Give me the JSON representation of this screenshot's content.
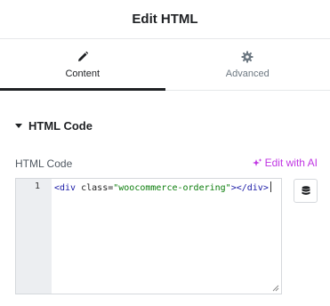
{
  "header": {
    "title": "Edit HTML"
  },
  "tabs": [
    {
      "label": "Content",
      "icon": "pencil-icon",
      "active": true
    },
    {
      "label": "Advanced",
      "icon": "gear-icon",
      "active": false
    }
  ],
  "section": {
    "title": "HTML Code"
  },
  "control": {
    "label": "HTML Code",
    "edit_ai_label": "Edit with AI"
  },
  "editor": {
    "line_number": "1",
    "tokens": {
      "open_tag": "<div",
      "attr": " class=",
      "value": "\"woocommerce-ordering\"",
      "close": "></div>"
    }
  },
  "colors": {
    "accent_ai": "#c036e3",
    "active_tab": "#1f2124",
    "gutter": "#eceef1"
  },
  "icons": {
    "dynamic_tags": "database-icon"
  }
}
